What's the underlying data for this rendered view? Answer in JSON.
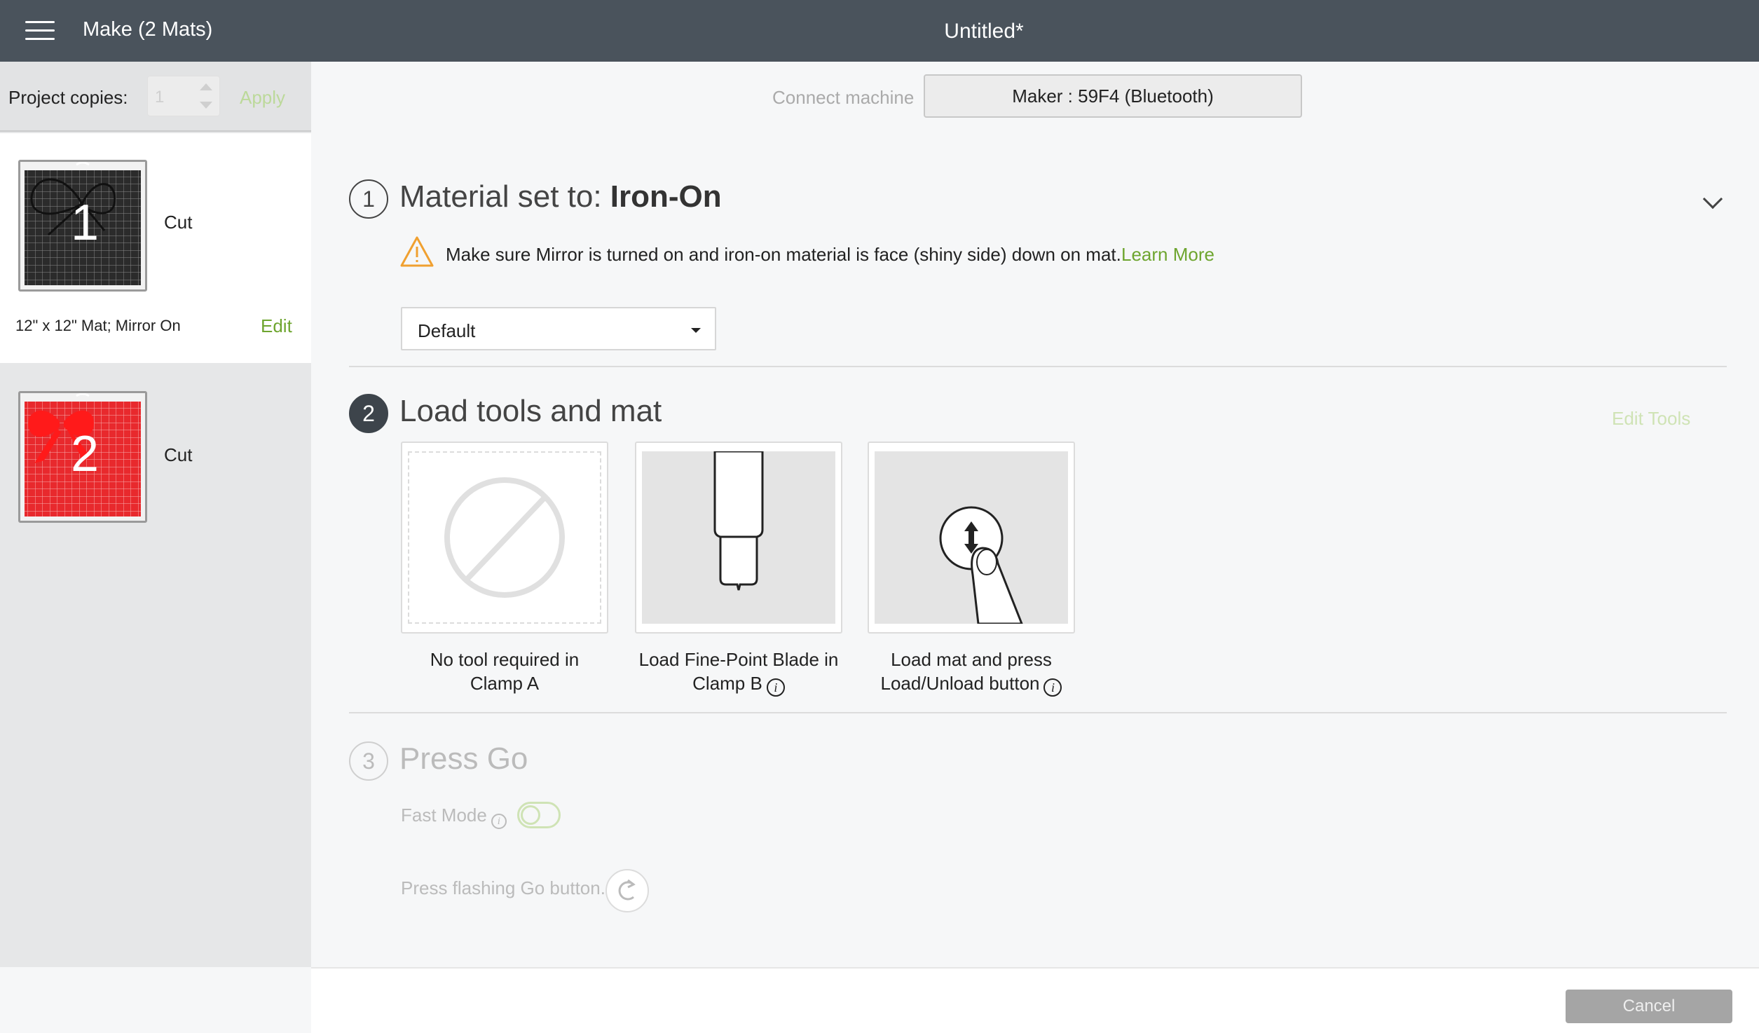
{
  "header": {
    "menu_icon": "hamburger-menu-icon",
    "make_title": "Make (2 Mats)",
    "document_title": "Untitled*"
  },
  "sidebar": {
    "copies_label": "Project copies:",
    "copies_value": "1",
    "apply_label": "Apply",
    "mats": [
      {
        "number": "1",
        "action": "Cut",
        "info": "12\" x 12\" Mat; Mirror On",
        "edit_label": "Edit",
        "color": "#2b2b2b",
        "selected": true
      },
      {
        "number": "2",
        "action": "Cut",
        "color": "#e8292d",
        "selected": false
      }
    ]
  },
  "connection": {
    "label": "Connect machine",
    "machine": "Maker : 59F4 (Bluetooth)"
  },
  "step1": {
    "number": "1",
    "title_prefix": "Material set to: ",
    "material": "Iron-On",
    "warning": "Make sure Mirror is turned on and iron-on material is face (shiny side) down on mat.",
    "learn_more": "Learn More",
    "pressure": "Default"
  },
  "step2": {
    "number": "2",
    "title": "Load tools and mat",
    "edit_tools": "Edit Tools",
    "cards": [
      {
        "caption_line1": "No tool required in",
        "caption_line2": "Clamp A"
      },
      {
        "caption_line1": "Load Fine-Point Blade in",
        "caption_line2": "Clamp B"
      },
      {
        "caption_line1": "Load mat and press",
        "caption_line2": "Load/Unload button"
      }
    ],
    "info_glyph": "i"
  },
  "step3": {
    "number": "3",
    "title": "Press Go",
    "fast_mode_label": "Fast Mode",
    "fast_mode_on": false,
    "go_label": "Press flashing Go button."
  },
  "footer": {
    "cancel_label": "Cancel"
  },
  "colors": {
    "topbar": "#4a535c",
    "accent_green": "#6ea52f",
    "warning_orange": "#f0a030"
  }
}
